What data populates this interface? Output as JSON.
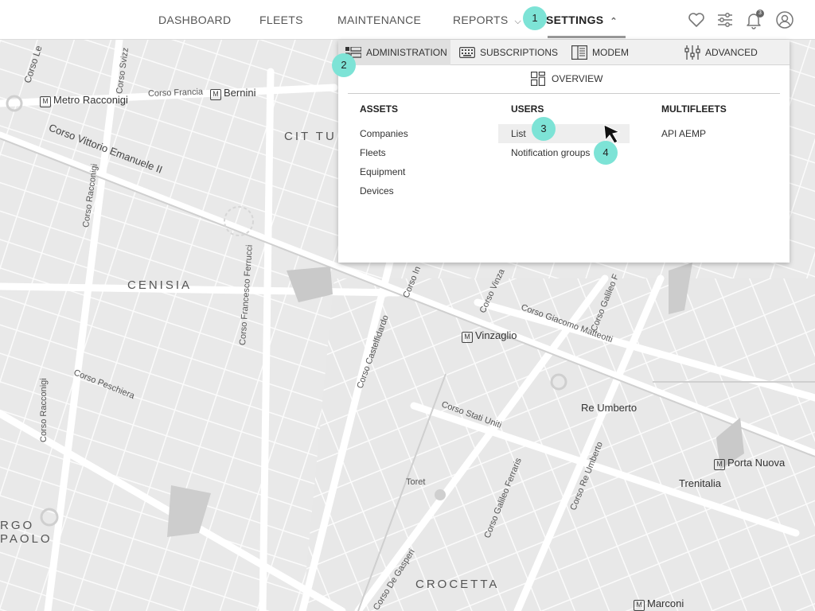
{
  "nav": {
    "items": [
      "DASHBOARD",
      "FLEETS",
      "MAINTENANCE",
      "REPORTS",
      "SETTINGS"
    ],
    "active": "SETTINGS",
    "notification_count": "3",
    "icons": [
      "heart-icon",
      "sliders-icon",
      "bell-icon",
      "user-icon"
    ]
  },
  "settings_menu": {
    "tabs": [
      {
        "label": "ADMINISTRATION",
        "icon": "admin-icon",
        "active": true
      },
      {
        "label": "SUBSCRIPTIONS",
        "icon": "keyboard-icon"
      },
      {
        "label": "MODEM",
        "icon": "modem-icon"
      },
      {
        "label": "ADVANCED",
        "icon": "sliders-vertical-icon"
      }
    ],
    "overview_label": "OVERVIEW",
    "columns": [
      {
        "heading": "ASSETS",
        "items": [
          "Companies",
          "Fleets",
          "Equipment",
          "Devices"
        ]
      },
      {
        "heading": "USERS",
        "items": [
          "List",
          "Notification groups"
        ]
      },
      {
        "heading": "MULTIFLEETS",
        "items": [
          "API AEMP"
        ]
      }
    ]
  },
  "annotations": [
    "1",
    "2",
    "3",
    "4"
  ],
  "annotation_color": "#7de3d6",
  "map": {
    "labels": {
      "metro_racconigi": "Metro Racconigi",
      "corso_francia": "Corso Francia",
      "bernini": "Bernini",
      "corso_vittorio": "Corso Vittorio Emanuele II",
      "cit_tu": "CIT TU",
      "cenisia": "CENISIA",
      "corso_ferrucci": "Corso Francesco Ferrucci",
      "corso_racconigi_a": "Corso Racconigi",
      "corso_racconigi_b": "Corso Racconigi",
      "corso_peschiera": "Corso Peschiera",
      "vinzaglio": "Vinzaglio",
      "corso_castelfidardo": "Corso Castelfidardo",
      "corso_matteotti": "Corso Giacomo Matteotti",
      "corso_stati_uniti": "Corso Stati Uniti",
      "re_umberto": "Re Umberto",
      "porta_nuova": "Porta Nuova",
      "trenitalia": "Trenitalia",
      "toret": "Toret",
      "corso_galileo_ferraris": "Corso Galileo Ferraris",
      "corso_re_umberto": "Corso Re Umberto",
      "borgo": "RGO",
      "paolo": "PAOLO",
      "crocetta": "CROCETTA",
      "de_gasperi": "Corso De Gasperi",
      "marconi": "Marconi",
      "corso_le": "Corso Le",
      "corso_svizzera": "Corso Svizz",
      "corso_vinzaglio": "Corso Vinza",
      "corso_galileo": "Corso Galileo F",
      "corso_in": "Corso In"
    }
  }
}
